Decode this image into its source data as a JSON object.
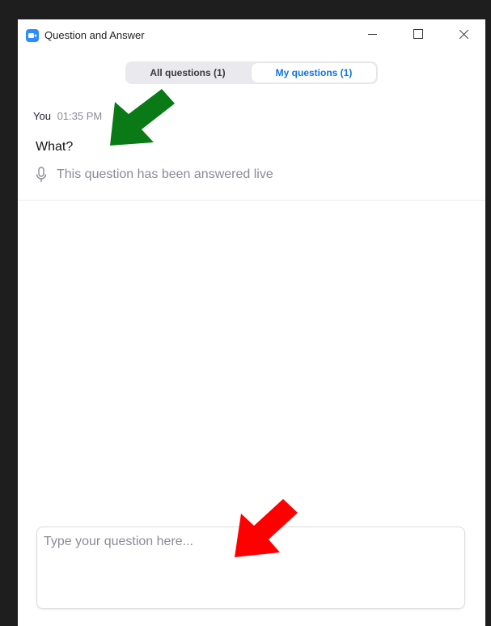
{
  "window": {
    "title": "Question and Answer",
    "controls": {
      "minimize": "minimize",
      "maximize": "maximize",
      "close": "close"
    }
  },
  "tabs": [
    {
      "label": "All questions (1)",
      "active": false
    },
    {
      "label": "My questions (1)",
      "active": true
    }
  ],
  "questions": [
    {
      "author": "You",
      "time": "01:35 PM",
      "text": "What?",
      "status": "This question has been answered live"
    }
  ],
  "input": {
    "placeholder": "Type your question here...",
    "value": ""
  },
  "annotations": {
    "arrow_1_color": "#0a7a16",
    "arrow_2_color": "#ff0000"
  },
  "colors": {
    "accent": "#0e71eb",
    "app_icon": "#2d8cff"
  }
}
